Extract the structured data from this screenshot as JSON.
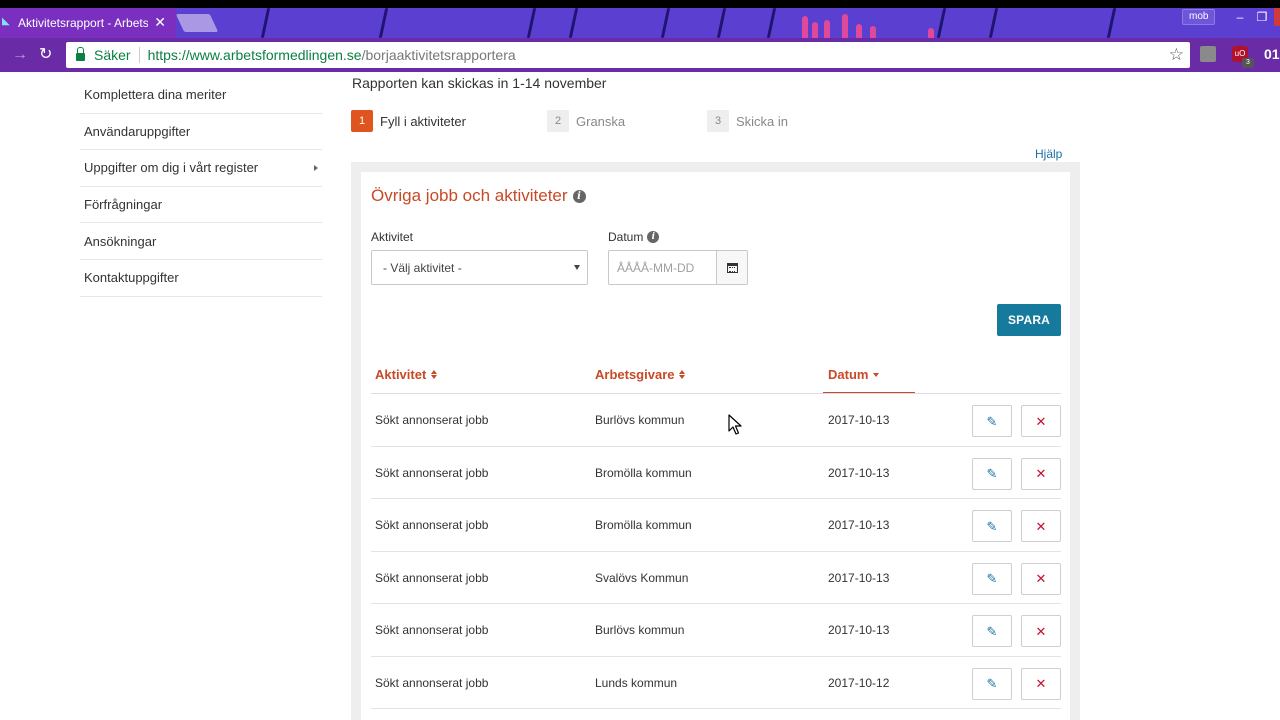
{
  "browser": {
    "tab_title": "Aktivitetsrapport - Arbetsförmedlingen",
    "tab_close": "✕",
    "profile": "mob",
    "secure_label": "Säker",
    "url_host": "https://www.arbetsformedlingen.se",
    "url_path": "/borjaaktivitetsrapportera",
    "ext_badge": "3",
    "ext_label": "uO",
    "clock_fragment": "01"
  },
  "sidebar": {
    "items": [
      {
        "label": "Komplettera dina meriter"
      },
      {
        "label": "Användaruppgifter"
      },
      {
        "label": "Uppgifter om dig i vårt register"
      },
      {
        "label": "Förfrågningar"
      },
      {
        "label": "Ansökningar"
      },
      {
        "label": "Kontaktuppgifter"
      }
    ]
  },
  "notice": "Rapporten kan skickas in 1-14 november",
  "steps": [
    {
      "num": "1",
      "label": "Fyll i aktiviteter",
      "active": true
    },
    {
      "num": "2",
      "label": "Granska",
      "active": false
    },
    {
      "num": "3",
      "label": "Skicka in",
      "active": false
    }
  ],
  "help": "Hjälp",
  "panel": {
    "title": "Övriga jobb och aktiviteter",
    "activity_label": "Aktivitet",
    "activity_selected": "- Välj aktivitet -",
    "date_label": "Datum",
    "date_placeholder": "ÅÅÅÅ-MM-DD",
    "save_label": "SPARA"
  },
  "table": {
    "headers": [
      "Aktivitet",
      "Arbetsgivare",
      "Datum"
    ],
    "rows": [
      [
        "Sökt annonserat jobb",
        "Burlövs kommun",
        "2017-10-13"
      ],
      [
        "Sökt annonserat jobb",
        "Bromölla kommun",
        "2017-10-13"
      ],
      [
        "Sökt annonserat jobb",
        "Bromölla kommun",
        "2017-10-13"
      ],
      [
        "Sökt annonserat jobb",
        "Svalövs Kommun",
        "2017-10-13"
      ],
      [
        "Sökt annonserat jobb",
        "Burlövs kommun",
        "2017-10-13"
      ],
      [
        "Sökt annonserat jobb",
        "Lunds kommun",
        "2017-10-12"
      ]
    ]
  },
  "colors": {
    "accent": "#c84a26",
    "step_active": "#e0541f",
    "primary_button": "#157a9c",
    "link": "#1a6fa3",
    "delete": "#c4122f"
  },
  "icons": {
    "info": "info-icon",
    "calendar": "calendar-icon",
    "edit": "pencil-icon",
    "delete": "times-icon"
  }
}
